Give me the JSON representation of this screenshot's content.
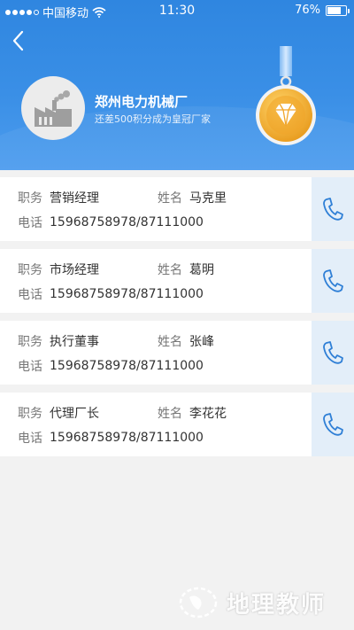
{
  "status_bar": {
    "carrier": "中国移动",
    "time": "11:30",
    "battery": "76%",
    "battery_level": 0.76
  },
  "company": {
    "name": "郑州电力机械厂",
    "subtitle": "还差500积分成为皇冠厂家"
  },
  "contacts": [
    {
      "position_label": "职务",
      "position": "营销经理",
      "name_label": "姓名",
      "name": "马克里",
      "phone_label": "电话",
      "phone": "15968758978/87111000"
    },
    {
      "position_label": "职务",
      "position": "市场经理",
      "name_label": "姓名",
      "name": "葛明",
      "phone_label": "电话",
      "phone": "15968758978/87111000"
    },
    {
      "position_label": "职务",
      "position": "执行董事",
      "name_label": "姓名",
      "name": "张峰",
      "phone_label": "电话",
      "phone": "15968758978/87111000"
    },
    {
      "position_label": "职务",
      "position": "代理厂长",
      "name_label": "姓名",
      "name": "李花花",
      "phone_label": "电话",
      "phone": "15968758978/87111000"
    }
  ],
  "watermark": {
    "text": "地理教师"
  },
  "colors": {
    "header": "#3a8fe6",
    "call_bg": "#e3eef9",
    "icon_blue": "#2f7fd6",
    "medal_gold": "#f2b640"
  },
  "icons": {
    "back": "chevron-left-icon",
    "call": "phone-icon",
    "medal": "diamond-medal-icon",
    "avatar": "factory-icon",
    "wifi": "wifi-icon"
  }
}
